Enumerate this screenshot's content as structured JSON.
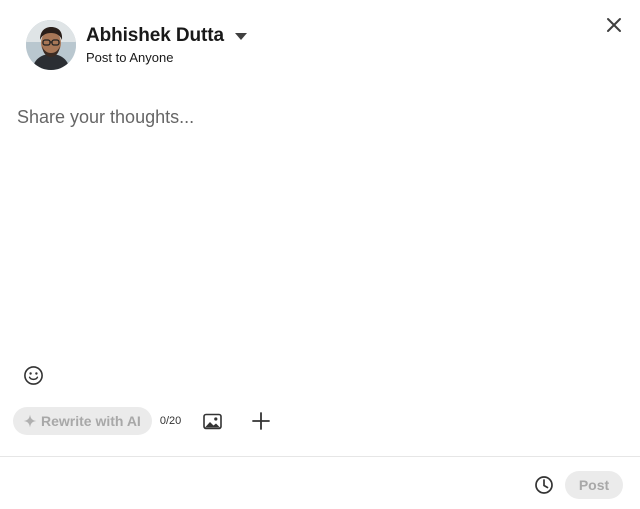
{
  "author": {
    "name": "Abhishek Dutta",
    "audience": "Post to Anyone"
  },
  "editor": {
    "placeholder": "Share your thoughts..."
  },
  "toolbar": {
    "ai_label": "Rewrite with AI",
    "char_count": "0/20"
  },
  "footer": {
    "post_label": "Post"
  },
  "icons": {
    "close": "close-icon",
    "emoji": "emoji-icon",
    "sparkle": "sparkle-icon",
    "media": "image-icon",
    "more": "plus-icon",
    "schedule": "clock-icon",
    "caret": "caret-down-icon"
  },
  "colors": {
    "disabled_button_bg": "#ebebeb",
    "disabled_button_text": "#a8a8a8",
    "placeholder_text": "#666666"
  }
}
